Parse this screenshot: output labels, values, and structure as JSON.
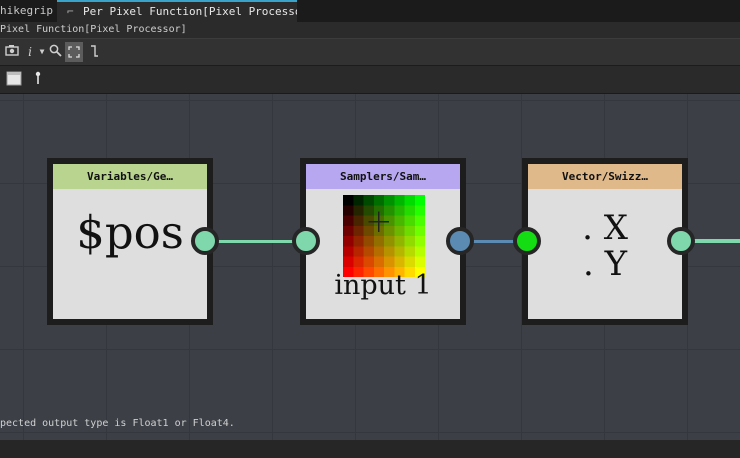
{
  "tabs": [
    {
      "label": "hikegrip"
    },
    {
      "label": "Per Pixel Function[Pixel Processor]",
      "icon": "node-graph-icon"
    }
  ],
  "window_title": "Pixel Function[Pixel Processor]",
  "toolbar": {
    "icons": [
      "camera-icon",
      "info-icon",
      "dropdown-arrow-icon",
      "zoom-icon",
      "fit-view-icon",
      "link-icon"
    ]
  },
  "toolbar2": {
    "icons": [
      "frame-icon",
      "pin-icon"
    ]
  },
  "nodes": [
    {
      "title": "Variables/Ge…",
      "header_color": "#b8d48e",
      "body_text": "$pos"
    },
    {
      "title": "Samplers/Sam…",
      "header_color": "#b7a6f0",
      "body_text": "input 1"
    },
    {
      "title": "Vector/Swizz…",
      "header_color": "#e0b98a",
      "body_lines": [
        ". X",
        ". Y"
      ]
    }
  ],
  "colors": {
    "float_port": "#7fd8ac",
    "vector_port": "#5b8ab3",
    "green_port": "#14dd14",
    "canvas_bg": "#3c3f46"
  },
  "status": {
    "message": "pected output type is Float1 or Float4."
  }
}
